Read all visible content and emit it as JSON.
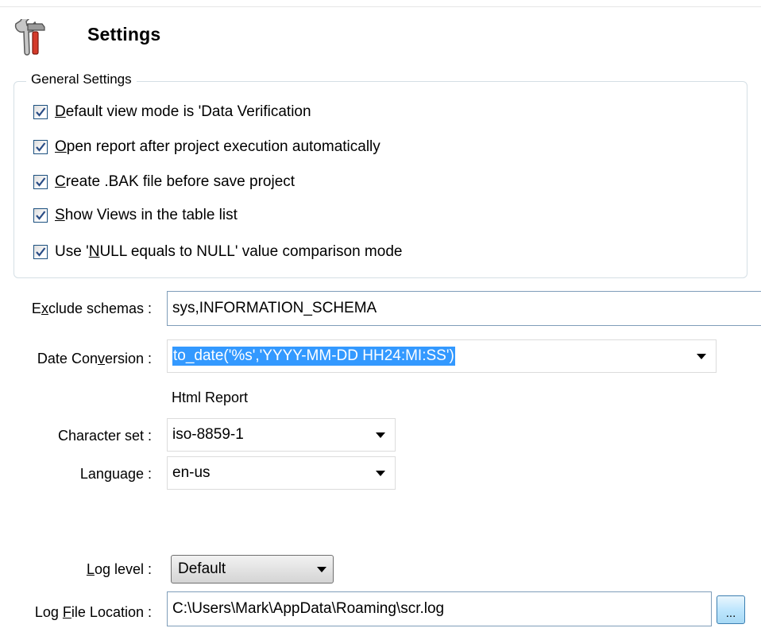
{
  "header": {
    "title": "Settings",
    "icon": "tools-icon"
  },
  "general": {
    "legend": "General Settings",
    "options": [
      {
        "pre": "",
        "key": "D",
        "post": "efault view mode is 'Data Verification",
        "checked": true
      },
      {
        "pre": "",
        "key": "O",
        "post": "pen report after project execution automatically",
        "checked": true
      },
      {
        "pre": "",
        "key": "C",
        "post": "reate .BAK file before save project",
        "checked": true
      },
      {
        "pre": "",
        "key": "S",
        "post": "how Views in the table list",
        "checked": true
      },
      {
        "pre": "Use '",
        "key": "N",
        "post": "ULL equals to NULL' value comparison mode",
        "checked": true
      }
    ]
  },
  "exclude": {
    "label_pre": "E",
    "label_key": "x",
    "label_post": "clude schemas :",
    "value": "sys,INFORMATION_SCHEMA"
  },
  "date_conversion": {
    "label_pre": "Date Con",
    "label_key": "v",
    "label_post": "ersion :",
    "value": "to_date('%s','YYYY-MM-DD HH24:MI:SS')"
  },
  "html_report": {
    "section_label": "Html Report",
    "charset": {
      "label": "Character set :",
      "value": "iso-8859-1"
    },
    "language": {
      "label": "Language :",
      "value": "en-us"
    }
  },
  "log": {
    "level": {
      "label_pre": "",
      "label_key": "L",
      "label_post": "og level :",
      "value": "Default"
    },
    "file": {
      "label_pre": "Log ",
      "label_key": "F",
      "label_post": "ile Location :",
      "value": "C:\\Users\\Mark\\AppData\\Roaming\\scr.log",
      "browse_label": "..."
    }
  },
  "colors": {
    "selection": "#3399ff",
    "group_border": "#d5dfe5",
    "input_border": "#7f9db9",
    "check_border": "#1c5180"
  }
}
